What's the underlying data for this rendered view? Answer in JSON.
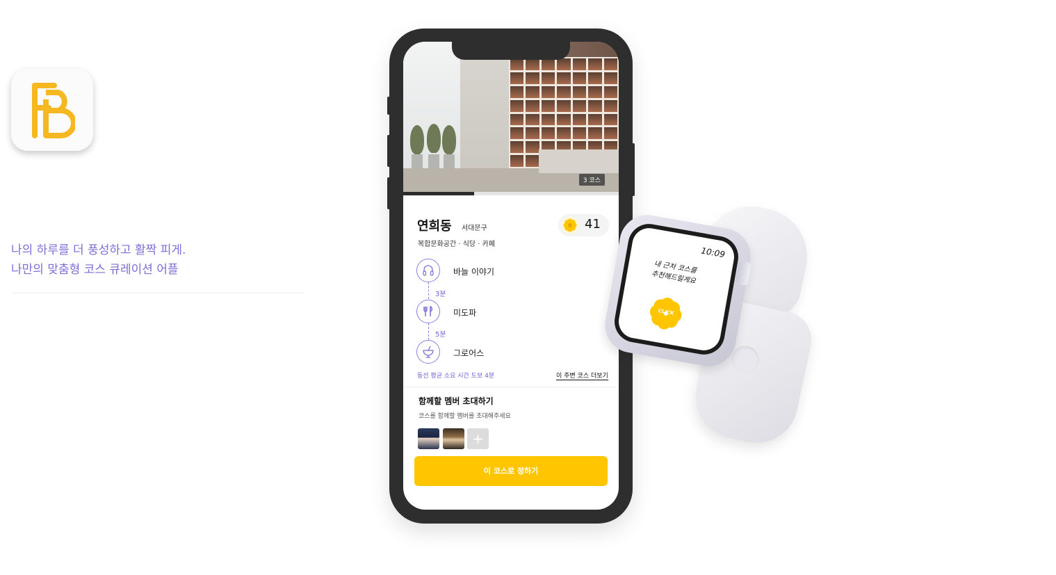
{
  "promo": {
    "tagline_line1": "나의 하루를 더 풍성하고 활짝 피게.",
    "tagline_line2": "나만의 맞춤형 코스 큐레이션 어플"
  },
  "colors": {
    "accent": "#ffc600",
    "purple": "#7c6fd8",
    "frame": "#2e2e2e"
  },
  "phone": {
    "hero": {
      "badge": "3 코스",
      "progress": 0.33
    },
    "place": {
      "name": "연희동",
      "district": "서대문구",
      "categories": "복합문화공간 · 식당 · 카페",
      "likes": "41"
    },
    "stops": [
      {
        "icon": "headphones-icon",
        "label": "바늘 이야기"
      },
      {
        "icon": "fork-knife-icon",
        "label": "미도파"
      },
      {
        "icon": "cocktail-icon",
        "label": "그로어스"
      }
    ],
    "walks": [
      "3분",
      "5분"
    ],
    "summary": "동선 평균 소요 시간 도보 4분",
    "more_link": "이 주변 코스 더보기",
    "invite": {
      "title": "함께할 멤버 초대하기",
      "subtitle": "코스를 함께할 멤버를 초대해주세요",
      "add": "+"
    },
    "cta": "이 코스로 정하기"
  },
  "watch": {
    "time": "10:09",
    "message_line1": "내 근처 코스를",
    "message_line2": "추천해드릴게요",
    "button": "CLICK"
  }
}
